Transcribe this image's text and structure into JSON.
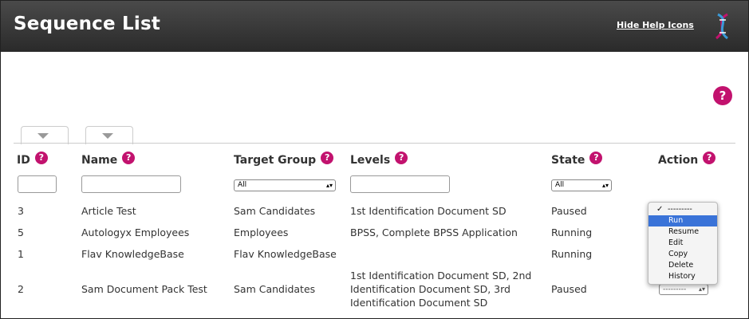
{
  "header": {
    "title": "Sequence List",
    "hide_help_link": "Hide Help Icons",
    "logo_icon": "dna-helix-icon"
  },
  "help_icon_glyph": "?",
  "columns": {
    "id": "ID",
    "name": "Name",
    "target_group": "Target Group",
    "levels": "Levels",
    "state": "State",
    "action": "Action"
  },
  "filters": {
    "target_group_select": "All",
    "state_select": "All"
  },
  "rows": [
    {
      "id": "3",
      "name": "Article Test",
      "target_group": "Sam Candidates",
      "levels": "1st Identification Document SD",
      "state": "Paused"
    },
    {
      "id": "5",
      "name": "Autologyx Employees",
      "target_group": "Employees",
      "levels": "BPSS, Complete BPSS Application",
      "state": "Running"
    },
    {
      "id": "1",
      "name": "Flav KnowledgeBase",
      "target_group": "Flav KnowledgeBase",
      "levels": "",
      "state": "Running"
    },
    {
      "id": "2",
      "name": "Sam Document Pack Test",
      "target_group": "Sam Candidates",
      "levels": "1st Identification Document SD, 2nd Identification Document SD, 3rd Identification Document SD",
      "state": "Paused",
      "levels_lines": [
        "1st Identification Document SD, 2nd",
        "Identification Document SD, 3rd",
        "Identification Document SD"
      ]
    }
  ],
  "action_dropdown": {
    "options": [
      "---------",
      "Run",
      "Resume",
      "Edit",
      "Copy",
      "Delete",
      "History"
    ],
    "selected": "---------",
    "highlighted": "Run"
  },
  "action_select_closed": "---------",
  "colors": {
    "header_bg": "#333333",
    "help_icon": "#c2126e",
    "highlight": "#3a73d8"
  }
}
